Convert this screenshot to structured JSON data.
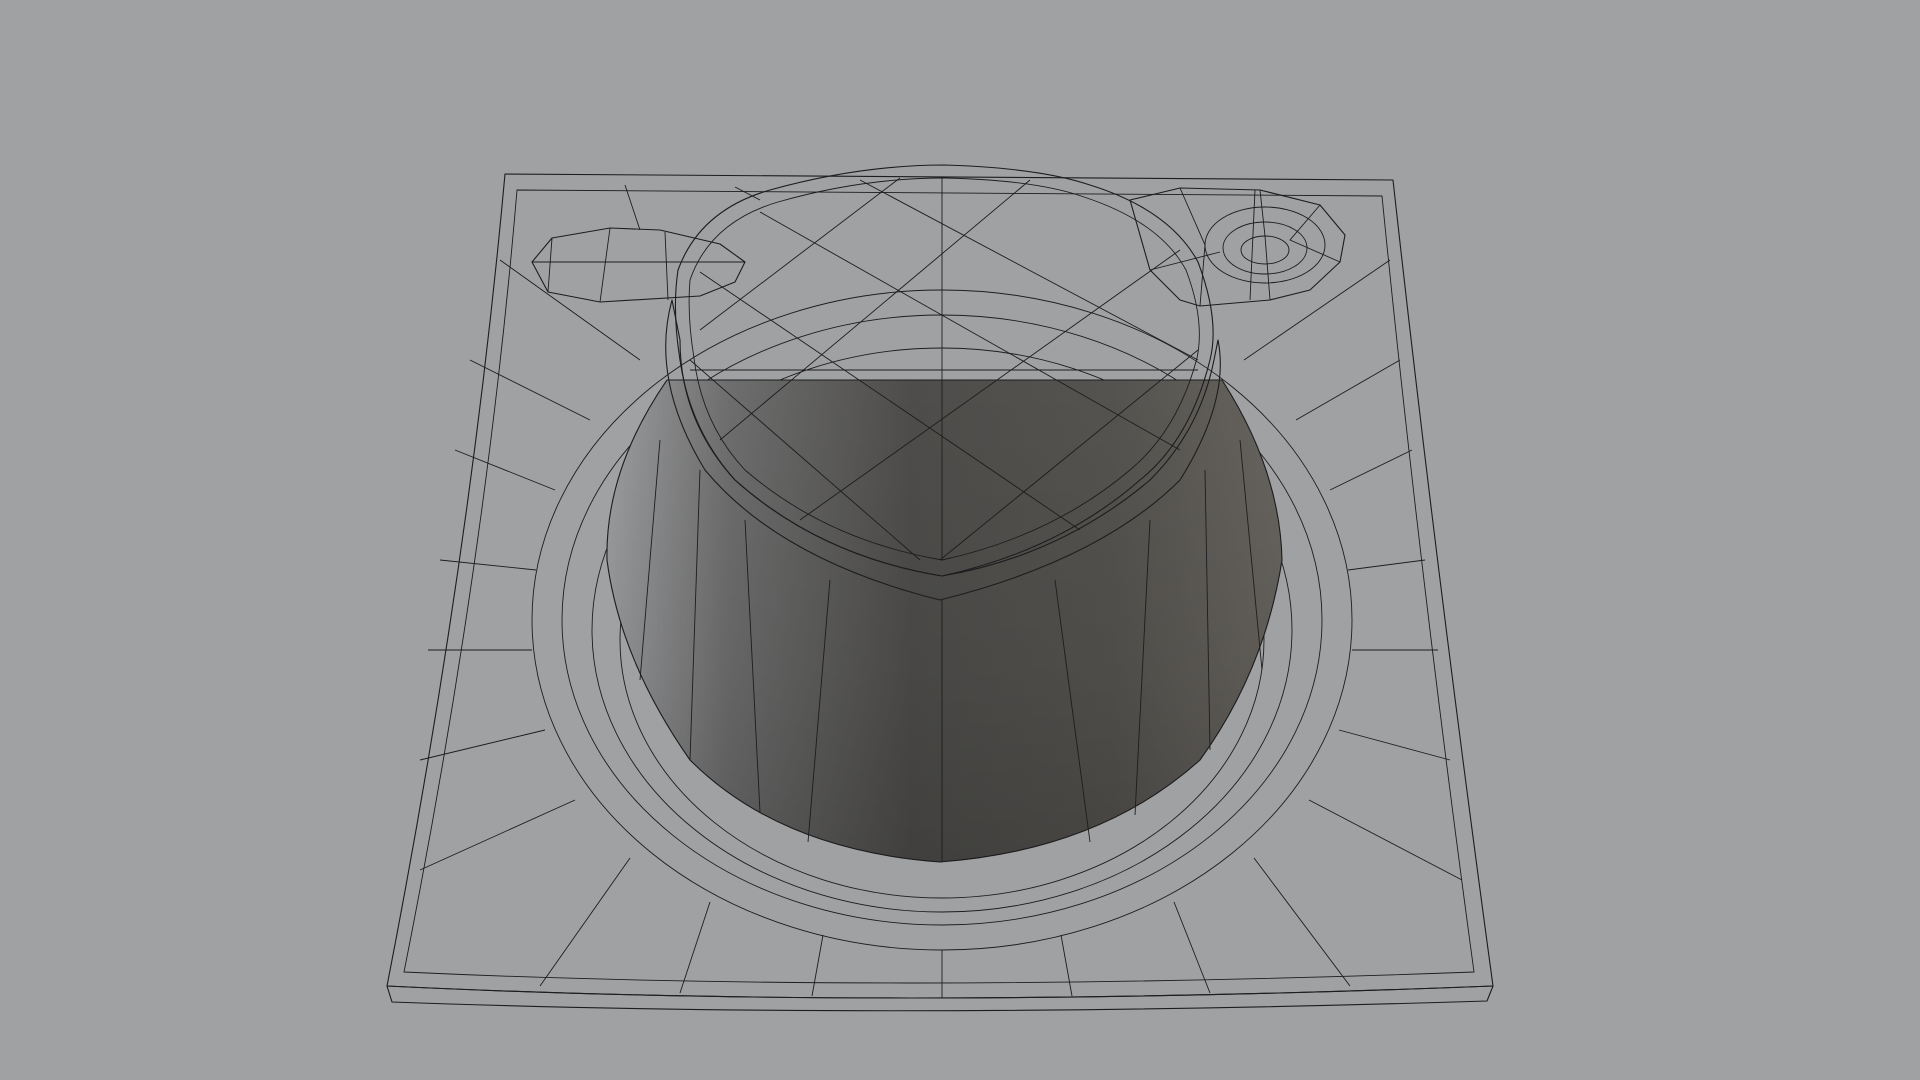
{
  "scene": {
    "background_color": "#a0a1a3",
    "surface_color": "#a9aaac",
    "cup_top_color": "#a4a5a7",
    "cup_side_dark": "#4c4b49",
    "cup_side_light": "#9c9d9f",
    "wire_color": "#1d1d1f",
    "objects": [
      "saucer-plate",
      "cup",
      "spoon-left",
      "spoon-right"
    ],
    "view": "wireframe-on-shaded"
  }
}
